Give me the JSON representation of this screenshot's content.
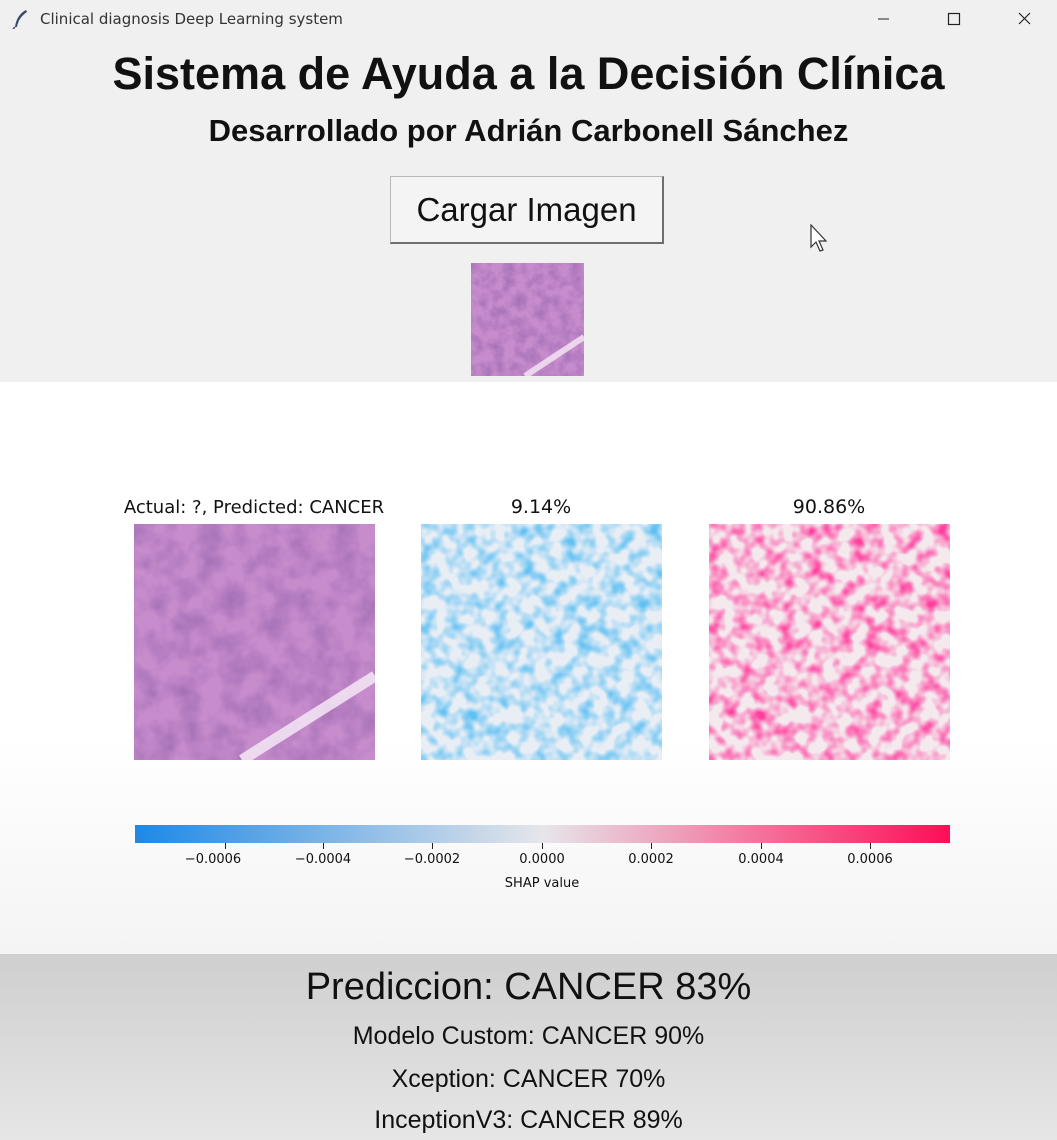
{
  "window": {
    "title": "Clinical diagnosis Deep Learning system"
  },
  "header": {
    "title": "Sistema de Ayuda a la Decisión Clínica",
    "subtitle": "Desarrollado por Adrián Carbonell Sánchez"
  },
  "load_button": {
    "label": "Cargar Imagen"
  },
  "figure": {
    "panel_titles": [
      "Actual: ?, Predicted: CANCER",
      "9.14%",
      "90.86%"
    ],
    "colorbar": {
      "label": "SHAP value",
      "ticks": [
        "−0.0006",
        "−0.0004",
        "−0.0002",
        "0.0000",
        "0.0002",
        "0.0004",
        "0.0006"
      ],
      "colors": [
        "#1e88e5",
        "#e6e6ea",
        "#ff0d57"
      ]
    }
  },
  "results": {
    "main": "Prediccion: CANCER 83%",
    "models": [
      "Modelo Custom: CANCER 90%",
      "Xception: CANCER 70%",
      "InceptionV3: CANCER 89%"
    ]
  }
}
